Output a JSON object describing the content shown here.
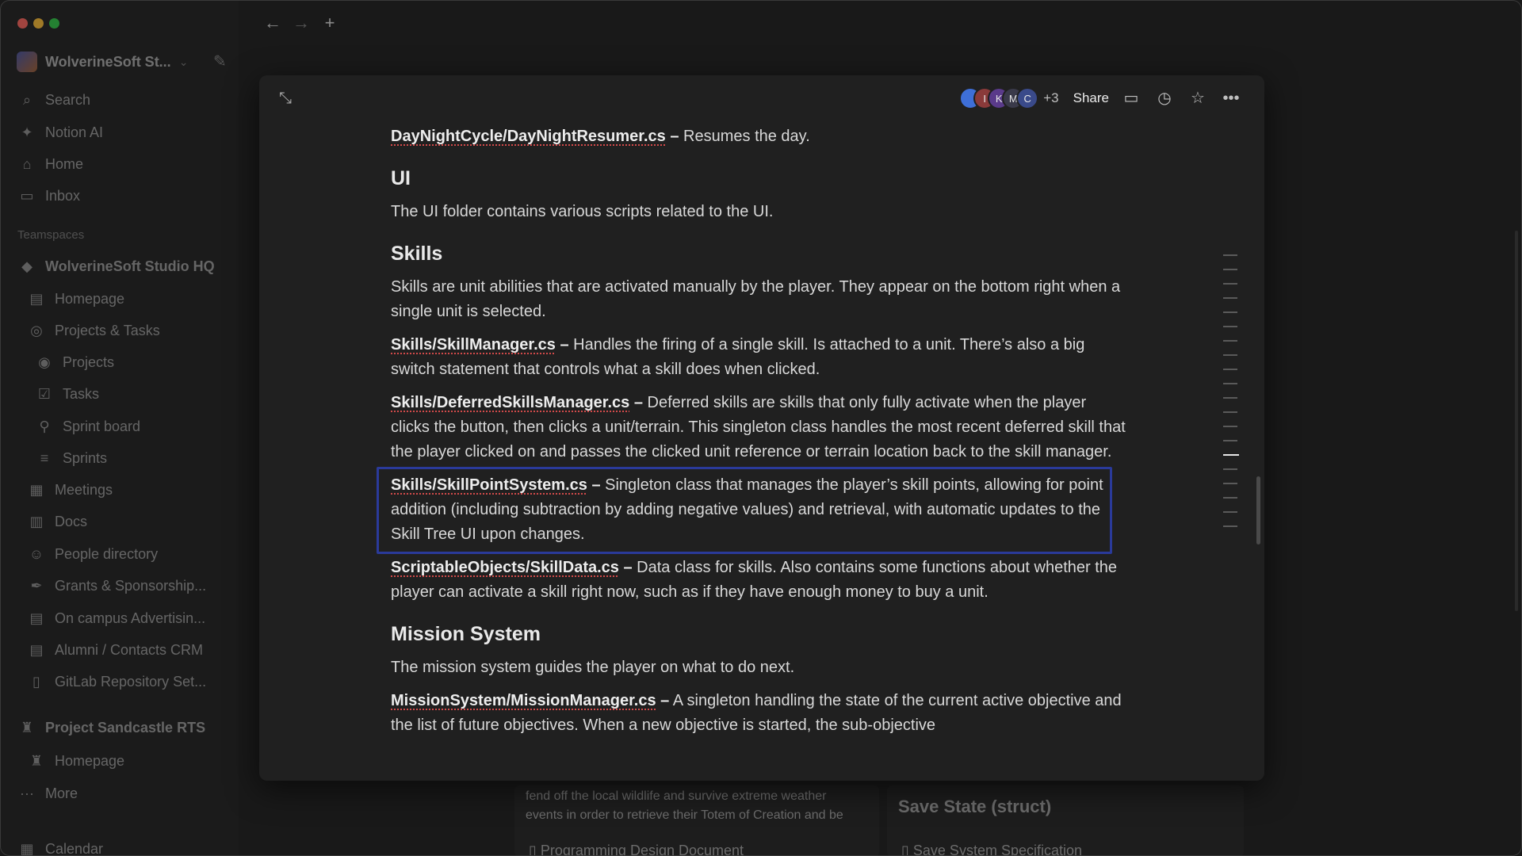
{
  "workspace": {
    "name": "WolverineSoft St..."
  },
  "sidebar": {
    "top_items": [
      {
        "label": "Search",
        "icon": "search-icon"
      },
      {
        "label": "Notion AI",
        "icon": "notion-ai-icon"
      },
      {
        "label": "Home",
        "icon": "home-icon"
      },
      {
        "label": "Inbox",
        "icon": "inbox-icon"
      }
    ],
    "teamspaces_label": "Teamspaces",
    "teamspace": "WolverineSoft Studio HQ",
    "items": [
      {
        "label": "Homepage",
        "level": 1
      },
      {
        "label": "Projects & Tasks",
        "level": 1
      },
      {
        "label": "Projects",
        "level": 2
      },
      {
        "label": "Tasks",
        "level": 2
      },
      {
        "label": "Sprint board",
        "level": 2
      },
      {
        "label": "Sprints",
        "level": 2
      },
      {
        "label": "Meetings",
        "level": 1
      },
      {
        "label": "Docs",
        "level": 1
      },
      {
        "label": "People directory",
        "level": 1
      },
      {
        "label": "Grants & Sponsorship...",
        "level": 1
      },
      {
        "label": "On campus Advertisin...",
        "level": 1
      },
      {
        "label": "Alumni / Contacts CRM",
        "level": 1
      },
      {
        "label": "GitLab Repository Set...",
        "level": 1
      }
    ],
    "project": "Project Sandcastle RTS",
    "project_items": [
      {
        "label": "Homepage"
      }
    ],
    "more": "More",
    "calendar": "Calendar"
  },
  "background": {
    "text_line1": "fend off the local wildlife and survive extreme weather",
    "text_line2": "events in order to retrieve their Totem of Creation and be",
    "card_title": "Save State (struct)",
    "link1": "Programming Design Document",
    "link2": "Save System Specification"
  },
  "topbar": {
    "avatars": [
      "",
      "I",
      "K",
      "M",
      "C"
    ],
    "more_count": "+3",
    "share": "Share"
  },
  "doc": {
    "line_daynight_code": "DayNightCycle/DayNightResumer.cs",
    "line_daynight_text": "Resumes the day.",
    "h_ui": "UI",
    "p_ui": "The UI folder contains various scripts related to the UI.",
    "h_skills": "Skills",
    "p_skills": "Skills are unit abilities that are activated manually by the player. They appear on the bottom right when a single unit is selected.",
    "skillmanager_code": "Skills/SkillManager.cs",
    "skillmanager_text": "Handles the firing of a single skill. Is attached to a unit. There’s also a big switch statement that controls what a skill does when clicked.",
    "deferred_code": "Skills/DeferredSkillsManager.cs",
    "deferred_text": "Deferred skills are skills that only fully activate when the player clicks the button, then clicks a unit/terrain. This singleton class handles the most recent deferred skill that the player clicked on and passes the clicked unit reference or terrain location back to the skill manager.",
    "skillpoint_code": "Skills/SkillPointSystem.cs",
    "skillpoint_text": "Singleton class that manages the player’s skill points, allowing for point addition (including subtraction by adding negative values) and retrieval, with automatic updates to the Skill Tree UI upon changes.",
    "skilldata_code": "ScriptableObjects/SkillData.cs",
    "skilldata_text": "Data class for skills. Also contains some functions about whether the player can activate a skill right now, such as if they have enough money to buy a unit.",
    "h_mission": "Mission System",
    "p_mission": "The mission system guides the player on what to do next.",
    "missionmanager_code": "MissionSystem/MissionManager.cs",
    "missionmanager_text": "A singleton handling the state of the current active objective and the list of future objectives. When a new objective is started, the sub-objective",
    "dash": "–"
  }
}
